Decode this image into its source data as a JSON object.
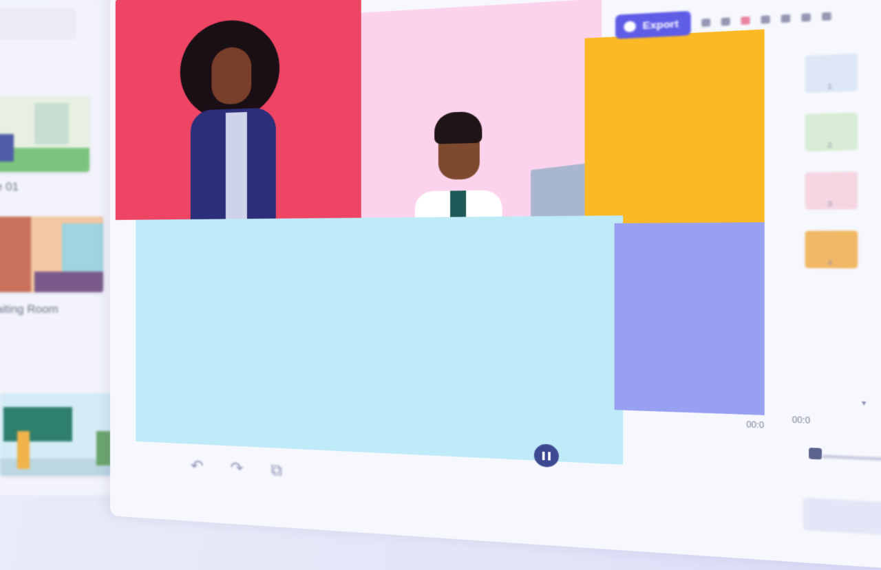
{
  "library": {
    "items": [
      {
        "label": "e 01"
      },
      {
        "label": "aiting Room"
      },
      {
        "label": ""
      }
    ]
  },
  "toolbar": {
    "export_label": "Export",
    "icons": [
      "layers-icon",
      "grid-icon",
      "record-icon",
      "share-icon",
      "minus-icon",
      "settings-icon",
      "close-icon"
    ]
  },
  "scenes": {
    "numbers": [
      "1",
      "2",
      "3",
      "4"
    ]
  },
  "playback": {
    "state": "playing",
    "time_left": "00:0",
    "time_right": "00:0"
  },
  "colors": {
    "accent": "#5f5ce6",
    "panel_red": "#ee4565",
    "panel_pink": "#fbd3ec",
    "panel_yellow": "#fbb925",
    "panel_cyan": "#bfeaf8",
    "panel_purple": "#98a1f1"
  }
}
